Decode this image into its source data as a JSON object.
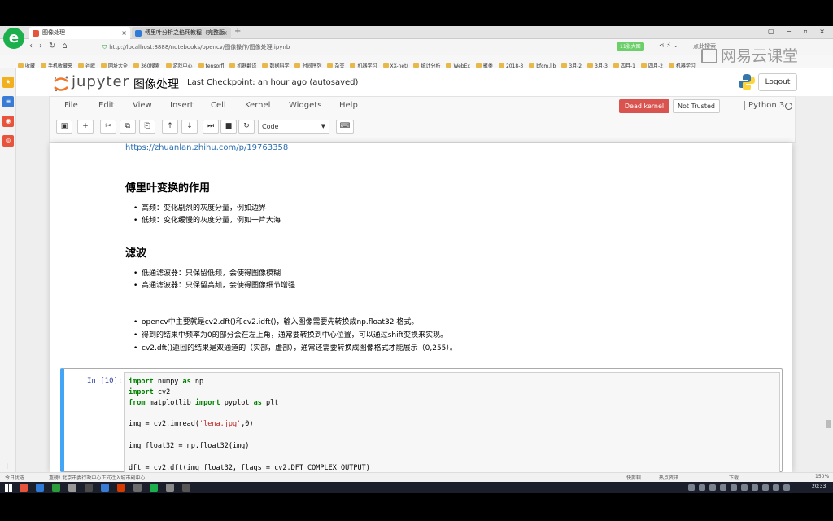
{
  "browser": {
    "logo_letter": "e",
    "tabs": [
      {
        "label": "图像处理",
        "color": "#e8533b"
      },
      {
        "label": "傅里叶分析之掐死教程（完整版",
        "color": "#2d7bd6"
      }
    ],
    "new_tab": "+",
    "window_controls": "▢ − ▫ ×",
    "url": "http://localhost:8888/notebooks/opencv/图像操作/图像处理.ipynb",
    "extension_badge": "11张大图",
    "search_hint": "点此搜索",
    "bookmarks": [
      "收藏",
      "手机收藏夹",
      "谷歌",
      "网址大全",
      "360搜索",
      "游戏中心",
      "tensorfl",
      "机器翻译",
      "数据科学",
      "时间序列",
      "杂交",
      "机器学习",
      "XX-net/",
      "统计分析",
      "WebEx",
      "聚类",
      "2018-3",
      "bfcm.lib",
      "3月-2",
      "3月-3",
      "四月-1",
      "四月-2",
      "机器学习"
    ],
    "watermark": "网易云课堂"
  },
  "jupyter": {
    "logo_text": "jupyter",
    "notebook_title": "图像处理",
    "checkpoint": "Last Checkpoint: an hour ago (autosaved)",
    "logout": "Logout",
    "menus": [
      "File",
      "Edit",
      "View",
      "Insert",
      "Cell",
      "Kernel",
      "Widgets",
      "Help"
    ],
    "kernel_badge": "Dead kernel",
    "trust_badge": "Not Trusted",
    "kernel_name": "Python 3",
    "toolbar_icons": [
      "save-icon",
      "plus-icon",
      "cut-icon",
      "copy-icon",
      "paste-icon",
      "arrow-up-icon",
      "arrow-down-icon",
      "step-icon",
      "stop-icon",
      "restart-icon"
    ],
    "toolbar_glyphs": [
      "▣",
      "+",
      "✂",
      "⧉",
      "⎗",
      "↑",
      "↓",
      "⏭",
      "■",
      "↻"
    ],
    "cell_type": "Code",
    "keyboard_glyph": "⌨"
  },
  "notebook": {
    "link": "https://zhuanlan.zhihu.com/p/19763358",
    "heading1": "傅里叶变换的作用",
    "list1": [
      "高频：变化剧烈的灰度分量，例如边界",
      "低频：变化缓慢的灰度分量，例如一片大海"
    ],
    "heading2": "滤波",
    "list2": [
      "低通滤波器：只保留低频，会使得图像模糊",
      "高通滤波器：只保留高频，会使得图像细节增强"
    ],
    "list3": [
      "opencv中主要就是cv2.dft()和cv2.idft()，输入图像需要先转换成np.float32 格式。",
      "得到的结果中频率为0的部分会在左上角，通常要转换到中心位置，可以通过shift变换来实现。",
      "cv2.dft()返回的结果是双通道的（实部，虚部），通常还需要转换成图像格式才能展示（0,255）。"
    ],
    "prompt": "In [10]:",
    "code": {
      "l1_kw": "import",
      "l1_rest": " numpy ",
      "l1_as": "as",
      "l1_end": " np",
      "l2_kw": "import",
      "l2_rest": " cv2",
      "l3_kw": "from",
      "l3_rest": " matplotlib ",
      "l3_kw2": "import",
      "l3_mid": " pyplot ",
      "l3_as": "as",
      "l3_end": " plt",
      "l4_pre": "img = cv2.imread(",
      "l4_str": "'lena.jpg'",
      "l4_post": ",0)",
      "l5": "img_float32 = np.float32(img)",
      "l6": "dft = cv2.dft(img_float32, flags = cv2.DFT_COMPLEX_OUTPUT)"
    }
  },
  "statusbar": {
    "left1": "今日优选",
    "left2": "重磅! 北京市委行政中心正式迁入城市副中心",
    "right": [
      "快剪辑",
      "热点资讯",
      "下载",
      "150%"
    ]
  },
  "taskbar": {
    "clock": "20:33",
    "app_colors": [
      "#e8533b",
      "#2d7bd6",
      "#2a9d3a",
      "#999",
      "#4a4a4a",
      "#3a7bd5",
      "#d83b01",
      "#6c6c6c",
      "#1bb04b",
      "#8a8a8a",
      "#555"
    ]
  }
}
